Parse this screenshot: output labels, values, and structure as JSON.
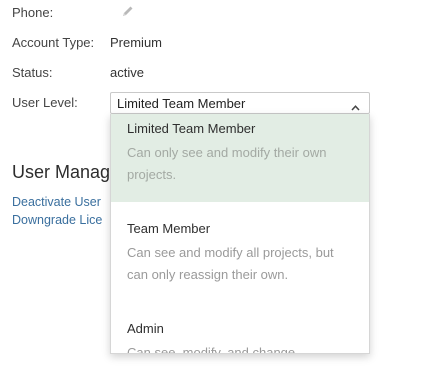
{
  "fields": {
    "phone_label": "Phone:",
    "account_type_label": "Account Type:",
    "account_type_value": "Premium",
    "status_label": "Status:",
    "status_value": "active",
    "user_level_label": "User Level:"
  },
  "user_level_select": {
    "value": "Limited Team Member",
    "icon": "chevron-up-icon"
  },
  "user_management": {
    "title": "User Manag",
    "links": [
      {
        "label": "Deactivate User"
      },
      {
        "label": "Downgrade Lice"
      }
    ]
  },
  "dropdown": {
    "options": [
      {
        "title": "Limited Team Member",
        "description": "Can only see and modify their own projects.",
        "selected": true
      },
      {
        "title": "Team Member",
        "description": "Can see and modify all projects, but can only reassign their own.",
        "selected": false
      },
      {
        "title": "Admin",
        "description": "Can see, modify, and change",
        "selected": false
      }
    ]
  },
  "colors": {
    "link": "#3a6f9e",
    "selected_option_bg": "#e2ede4",
    "muted_text": "#9a9a9a"
  },
  "icons": {
    "phone_edit": "pencil-icon"
  }
}
